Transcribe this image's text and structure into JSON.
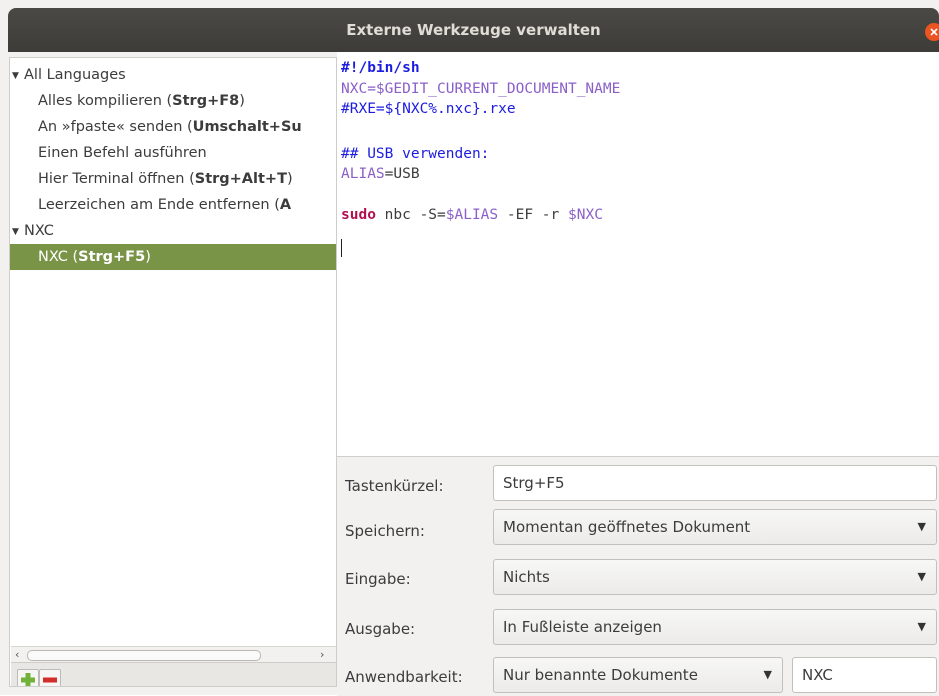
{
  "window": {
    "title": "Externe Werkzeuge verwalten"
  },
  "tree": {
    "categories": [
      {
        "label": "All Languages",
        "items": [
          {
            "text": "Alles kompilieren (",
            "key": "Strg+F8",
            "tail": ")"
          },
          {
            "text": "An »fpaste« senden (",
            "key": "Umschalt+Su",
            "tail": ""
          },
          {
            "text": "Einen Befehl ausführen",
            "key": "",
            "tail": ""
          },
          {
            "text": "Hier Terminal öffnen (",
            "key": "Strg+Alt+T",
            "tail": ")"
          },
          {
            "text": "Leerzeichen am Ende entfernen (",
            "key": "A",
            "tail": ""
          }
        ]
      },
      {
        "label": "NXC",
        "items": [
          {
            "text": "NXC (",
            "key": "Strg+F5",
            "tail": ")"
          }
        ]
      }
    ],
    "selected_item": "NXC (Strg+F5)"
  },
  "editor": {
    "lines": [
      [
        {
          "t": "#!/bin/sh",
          "c": "shebang"
        }
      ],
      [
        {
          "t": "NXC=$GEDIT_CURRENT_DOCUMENT_NAME",
          "c": "var"
        }
      ],
      [
        {
          "t": "#RXE=${NXC%.nxc}.rxe",
          "c": "blue"
        }
      ],
      [
        {
          "t": "",
          "c": "plain"
        }
      ],
      [
        {
          "t": "## USB verwenden:",
          "c": "blue"
        }
      ],
      [
        {
          "t": "ALIAS",
          "c": "var"
        },
        {
          "t": "=USB",
          "c": "plain"
        }
      ],
      [
        {
          "t": "",
          "c": "plain"
        }
      ],
      [
        {
          "t": "sudo",
          "c": "kw"
        },
        {
          "t": " nbc -S=",
          "c": "plain"
        },
        {
          "t": "$ALIAS",
          "c": "var"
        },
        {
          "t": " -EF -r ",
          "c": "plain"
        },
        {
          "t": "$NXC",
          "c": "var"
        }
      ]
    ]
  },
  "form": {
    "shortcut_label": "Tastenkürzel:",
    "shortcut_value": "Strg+F5",
    "save_label": "Speichern:",
    "save_value": "Momentan geöffnetes Dokument",
    "input_label": "Eingabe:",
    "input_value": "Nichts",
    "output_label": "Ausgabe:",
    "output_value": "In Fußleiste anzeigen",
    "applicability_label": "Anwendbarkeit:",
    "applicability_value": "Nur benannte Dokumente",
    "language_value": "NXC"
  },
  "colors": {
    "selection": "#7a9447",
    "titlebar": "#3d3c38",
    "close": "#e95420",
    "add_icon": "#73b23a",
    "remove_icon": "#d42b2b"
  },
  "icons": {
    "add": "plus-icon",
    "remove": "minus-icon",
    "close": "close-icon",
    "dropdown": "chevron-down-icon"
  }
}
